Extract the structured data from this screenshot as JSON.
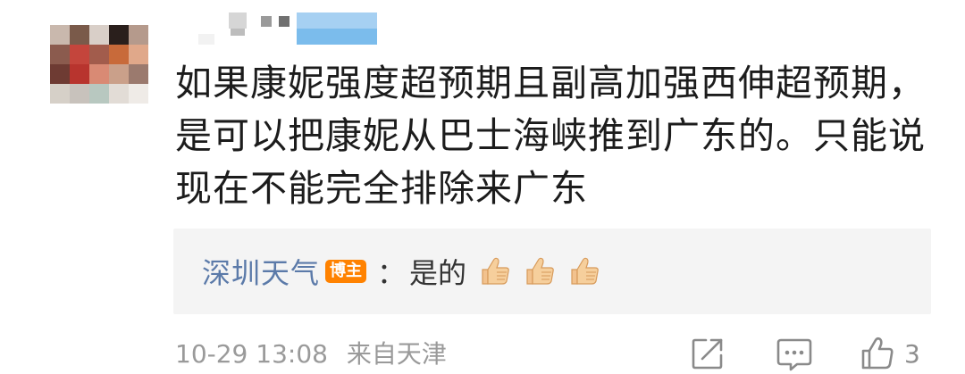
{
  "comment": {
    "text_lines": [
      "如果康妮强度超预期且副高加强西伸超预期，",
      "是可以把康妮从巴士海峡推到广东的。只能说",
      "现在不能完全排除来广东"
    ],
    "reply": {
      "author": "深圳天气",
      "badge": "博主",
      "separator": "：",
      "text": "是的",
      "emojis": [
        "thumbs-up-emoji",
        "thumbs-up-emoji",
        "thumbs-up-emoji"
      ]
    },
    "meta": {
      "date": "10-29 13:08",
      "location": "来自天津"
    },
    "actions": {
      "share_icon": "share-square-icon",
      "comment_icon": "comment-bubble-icon",
      "like_icon": "thumbs-up-outline-icon",
      "like_count": "3"
    }
  },
  "colors": {
    "author_link": "#5b7aa9",
    "badge": "#ff8200",
    "reply_bg": "#f4f4f4",
    "meta_gray": "#9a9a9a",
    "text": "#1c1c1c"
  }
}
